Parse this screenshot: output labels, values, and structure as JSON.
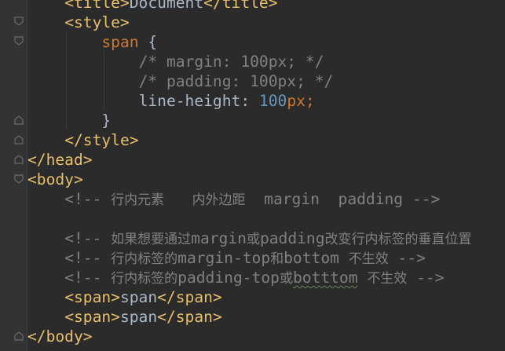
{
  "colors": {
    "background": "#2b2b2b",
    "gutter": "#313335",
    "tag": "#e8bf6a",
    "selector": "#cc7832",
    "comment": "#808080",
    "number": "#6897bb",
    "text": "#a9b7c6"
  },
  "icons": [
    "fold-marker-icon"
  ],
  "code": {
    "title_open": "<title>",
    "title_text": "Document",
    "title_close": "</title>",
    "style_open": "<style>",
    "selector": "span",
    "brace_open": "{",
    "comment_margin": "/* margin: 100px; */",
    "comment_padding": "/* padding: 100px; */",
    "prop_name": "line-height:",
    "prop_num": "100",
    "prop_unit": "px",
    "semicolon": ";",
    "brace_close": "}",
    "style_close": "</style>",
    "head_close": "</head>",
    "body_open": "<body>",
    "c1_open": "<!--",
    "c1_cn": "行内元素",
    "c1_cn2": "内外边距",
    "c1_en": "margin  padding -->",
    "c2_open": "<!--",
    "c2_cn_a": "如果想要通过",
    "c2_en_a": "margin",
    "c2_cn_b": "或",
    "c2_en_b": "padding",
    "c2_cn_c": "改变行内标签的垂直位置",
    "c3_open": "<!--",
    "c3_cn_a": "行内标签的",
    "c3_en_a": "margin-top",
    "c3_cn_b": "和",
    "c3_en_b": "bottom",
    "c3_cn_c": "不生效",
    "c3_close": "-->",
    "c4_open": "<!--",
    "c4_cn_a": "行内标签的",
    "c4_en_a": "padding-top",
    "c4_cn_b": "或",
    "c4_en_b": "botttom",
    "c4_cn_c": "不生效",
    "c4_close": "-->",
    "span_open": "<span>",
    "span_text": "span",
    "span_close": "</span>",
    "body_close": "</body>"
  }
}
